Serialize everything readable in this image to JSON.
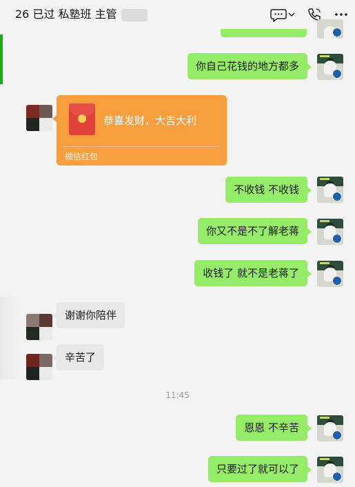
{
  "header": {
    "title": "26 已过 私塾班 主管",
    "icons": [
      "chat-bubble-icon",
      "chevron-down-icon",
      "phone-icon",
      "more-icon"
    ]
  },
  "messages": [
    {
      "side": "self",
      "text": "你自己花钱的地方都多"
    },
    {
      "side": "other",
      "type": "red-packet",
      "text": "恭喜发财，大吉大利",
      "footer": "微信红包"
    },
    {
      "side": "self",
      "text": "不收钱 不收钱"
    },
    {
      "side": "self",
      "text": "你又不是不了解老蒋"
    },
    {
      "side": "self",
      "text": "收钱了 就不是老蒋了"
    },
    {
      "side": "other",
      "text": "谢谢你陪伴"
    },
    {
      "side": "other",
      "text": "辛苦了"
    },
    {
      "side": "self",
      "text": "恩恩 不辛苦"
    },
    {
      "side": "self",
      "text": "只要过了就可以了"
    }
  ],
  "timestamp": "11:45",
  "colors": {
    "self_bubble": "#95ec69",
    "other_bubble": "#e8e8e8",
    "red_packet": "#f79f3e",
    "background": "#f3f3f3",
    "accent_bar": "#1aad19"
  }
}
